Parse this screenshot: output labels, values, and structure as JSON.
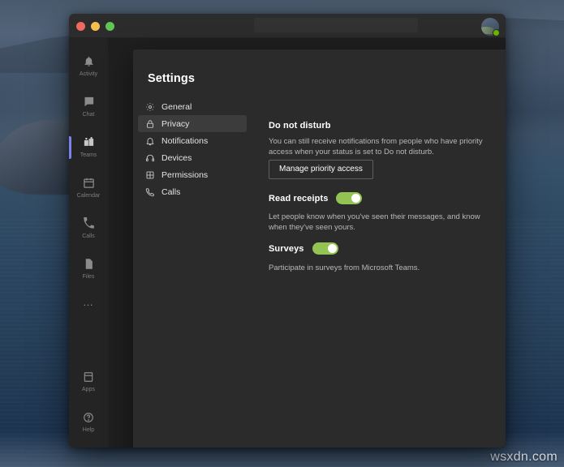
{
  "watermark": "wsxdn.com",
  "window": {
    "traffic_lights": [
      "close",
      "minimize",
      "maximize"
    ],
    "search_placeholder": "",
    "avatar_presence": "available"
  },
  "app_rail": {
    "items": [
      {
        "label": "Activity",
        "icon": "bell-icon",
        "active": false
      },
      {
        "label": "Chat",
        "icon": "chat-icon",
        "active": false
      },
      {
        "label": "Teams",
        "icon": "teams-icon",
        "active": true
      },
      {
        "label": "Calendar",
        "icon": "calendar-icon",
        "active": false
      },
      {
        "label": "Calls",
        "icon": "phone-icon",
        "active": false
      },
      {
        "label": "Files",
        "icon": "files-icon",
        "active": false
      }
    ],
    "more_label": "…",
    "bottom_items": [
      {
        "label": "Apps",
        "icon": "apps-icon"
      },
      {
        "label": "Help",
        "icon": "help-icon"
      }
    ]
  },
  "modal": {
    "title": "Settings",
    "close_label": "✕",
    "overflow_label": "•••",
    "nav": [
      {
        "label": "General",
        "icon": "gear-icon",
        "selected": false
      },
      {
        "label": "Privacy",
        "icon": "lock-icon",
        "selected": true
      },
      {
        "label": "Notifications",
        "icon": "bell-icon",
        "selected": false
      },
      {
        "label": "Devices",
        "icon": "headset-icon",
        "selected": false
      },
      {
        "label": "Permissions",
        "icon": "grid-icon",
        "selected": false
      },
      {
        "label": "Calls",
        "icon": "phone-icon",
        "selected": false
      }
    ],
    "sections": {
      "do_not_disturb": {
        "title": "Do not disturb",
        "description": "You can still receive notifications from people who have priority access when your status is set to Do not disturb.",
        "button_label": "Manage priority access"
      },
      "read_receipts": {
        "title": "Read receipts",
        "toggle_state": "on",
        "description": "Let people know when you've seen their messages, and know when they've seen yours."
      },
      "surveys": {
        "title": "Surveys",
        "toggle_state": "on",
        "description": "Participate in surveys from Microsoft Teams."
      }
    }
  },
  "colors": {
    "accent": "#7b83eb",
    "toggle_on": "#92c353",
    "presence_available": "#6bb700",
    "modal_bg": "#2b2b2b",
    "window_bg": "#1f1f1f"
  }
}
